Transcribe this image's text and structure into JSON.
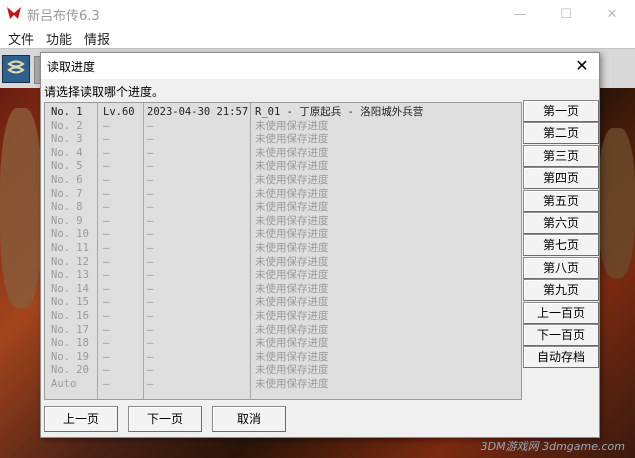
{
  "app": {
    "title": "新吕布传6.3",
    "menu": [
      "文件",
      "功能",
      "情报"
    ],
    "watermark": "3DM游戏网 3dmgame.com"
  },
  "dialog": {
    "title": "读取进度",
    "close_label": "✕",
    "prompt": "请选择读取哪个进度。",
    "saves": [
      {
        "no": "No.  1",
        "lv": "Lv.60",
        "date": "2023-04-30 21:57",
        "title": "R_01 - 丁原起兵 - 洛阳城外兵营",
        "used": true
      },
      {
        "no": "No.  2",
        "lv": "—",
        "date": "—",
        "title": "未使用保存进度",
        "used": false
      },
      {
        "no": "No.  3",
        "lv": "—",
        "date": "—",
        "title": "未使用保存进度",
        "used": false
      },
      {
        "no": "No.  4",
        "lv": "—",
        "date": "—",
        "title": "未使用保存进度",
        "used": false
      },
      {
        "no": "No.  5",
        "lv": "—",
        "date": "—",
        "title": "未使用保存进度",
        "used": false
      },
      {
        "no": "No.  6",
        "lv": "—",
        "date": "—",
        "title": "未使用保存进度",
        "used": false
      },
      {
        "no": "No.  7",
        "lv": "—",
        "date": "—",
        "title": "未使用保存进度",
        "used": false
      },
      {
        "no": "No.  8",
        "lv": "—",
        "date": "—",
        "title": "未使用保存进度",
        "used": false
      },
      {
        "no": "No.  9",
        "lv": "—",
        "date": "—",
        "title": "未使用保存进度",
        "used": false
      },
      {
        "no": "No. 10",
        "lv": "—",
        "date": "—",
        "title": "未使用保存进度",
        "used": false
      },
      {
        "no": "No. 11",
        "lv": "—",
        "date": "—",
        "title": "未使用保存进度",
        "used": false
      },
      {
        "no": "No. 12",
        "lv": "—",
        "date": "—",
        "title": "未使用保存进度",
        "used": false
      },
      {
        "no": "No. 13",
        "lv": "—",
        "date": "—",
        "title": "未使用保存进度",
        "used": false
      },
      {
        "no": "No. 14",
        "lv": "—",
        "date": "—",
        "title": "未使用保存进度",
        "used": false
      },
      {
        "no": "No. 15",
        "lv": "—",
        "date": "—",
        "title": "未使用保存进度",
        "used": false
      },
      {
        "no": "No. 16",
        "lv": "—",
        "date": "—",
        "title": "未使用保存进度",
        "used": false
      },
      {
        "no": "No. 17",
        "lv": "—",
        "date": "—",
        "title": "未使用保存进度",
        "used": false
      },
      {
        "no": "No. 18",
        "lv": "—",
        "date": "—",
        "title": "未使用保存进度",
        "used": false
      },
      {
        "no": "No. 19",
        "lv": "—",
        "date": "—",
        "title": "未使用保存进度",
        "used": false
      },
      {
        "no": "No. 20",
        "lv": "—",
        "date": "—",
        "title": "未使用保存进度",
        "used": false
      },
      {
        "no": "Auto",
        "lv": "—",
        "date": "—",
        "title": "未使用保存进度",
        "used": false
      }
    ],
    "side_buttons": [
      "第一页",
      "第二页",
      "第三页",
      "第四页",
      "第五页",
      "第六页",
      "第七页",
      "第八页",
      "第九页",
      "上一百页",
      "下一百页",
      "自动存档"
    ],
    "bottom_buttons": [
      "上一页",
      "下一页",
      "取消"
    ]
  }
}
